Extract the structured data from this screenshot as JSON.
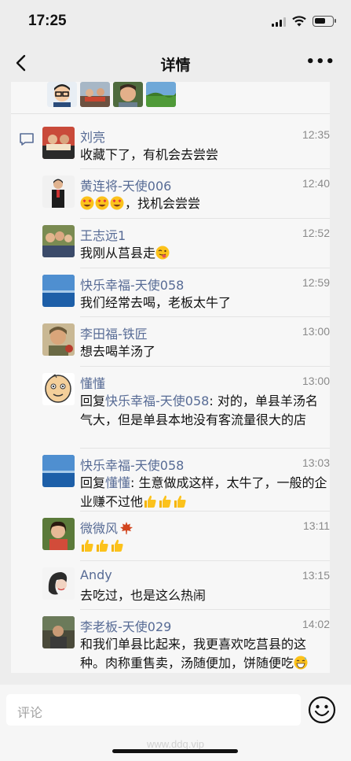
{
  "status_bar": {
    "time": "17:25"
  },
  "nav": {
    "title": "详情",
    "back_icon": "chevron-left-icon",
    "more_label": "•••"
  },
  "likes": [
    "avatar-cartoon-glasses",
    "avatar-group-photo",
    "avatar-man-smiling",
    "avatar-landscape"
  ],
  "comments": [
    {
      "name": "刘亮",
      "time": "12:35",
      "text": "收藏下了，有机会去尝尝",
      "emoji_prefix": [],
      "emoji_suffix": []
    },
    {
      "name": "黄连将-天使006",
      "time": "12:40",
      "text": "，找机会尝尝",
      "emoji_prefix": [
        "heart-eyes",
        "heart-eyes",
        "heart-eyes"
      ],
      "emoji_suffix": []
    },
    {
      "name": "王志远1",
      "time": "12:52",
      "text": "我刚从莒县走",
      "emoji_prefix": [],
      "emoji_suffix": [
        "tongue-face"
      ]
    },
    {
      "name": "快乐幸福-天使058",
      "time": "12:59",
      "text": "我们经常去喝，老板太牛了",
      "emoji_prefix": [],
      "emoji_suffix": []
    },
    {
      "name": "李田福-铁匠",
      "time": "13:00",
      "text": "想去喝羊汤了",
      "emoji_prefix": [],
      "emoji_suffix": []
    },
    {
      "name": "懂懂",
      "time": "13:00",
      "reply_prefix": "回复",
      "reply_to": "快乐幸福-天使058",
      "text": ": 对的，单县羊汤名气大，但是单县本地没有客流量很大的店",
      "emoji_prefix": [],
      "emoji_suffix": []
    },
    {
      "name": "快乐幸福-天使058",
      "time": "13:03",
      "reply_prefix": "回复",
      "reply_to": "懂懂",
      "text": ": 生意做成这样，太牛了，一般的企业赚不过他",
      "emoji_prefix": [],
      "emoji_suffix": [
        "thumbs-up",
        "thumbs-up",
        "thumbs-up"
      ]
    },
    {
      "name": "微微风",
      "time": "13:11",
      "text": "",
      "emoji_prefix": [
        "thumbs-up",
        "thumbs-up",
        "thumbs-up"
      ],
      "emoji_suffix": [],
      "name_emoji": "maple-leaf"
    },
    {
      "name": "Andy",
      "time": "13:15",
      "text": "去吃过，也是这么热闹",
      "emoji_prefix": [],
      "emoji_suffix": []
    },
    {
      "name": "李老板-天使029",
      "time": "14:02",
      "text": "和我们单县比起来，我更喜欢吃莒县的这种。肉称重售卖，汤随便加，饼随便吃",
      "emoji_prefix": [],
      "emoji_suffix": [
        "grinning-sweat"
      ]
    }
  ],
  "input": {
    "placeholder": "评论",
    "emoji_icon": "smiley-icon"
  },
  "watermark": "www.ddq.vip",
  "colors": {
    "link": "#576b95",
    "background": "#ededed",
    "panel": "#f7f7f7"
  }
}
